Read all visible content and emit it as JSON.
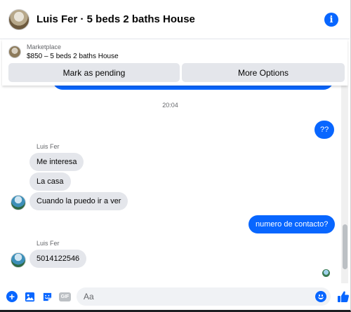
{
  "header": {
    "title": "Luis Fer · 5 beds 2 baths House",
    "info_icon": "info-icon"
  },
  "marketplace": {
    "label": "Marketplace",
    "listing": "$850 – 5 beds 2 baths House",
    "buttons": {
      "pending": "Mark as pending",
      "more": "More Options"
    }
  },
  "chat": {
    "timestamp": "20:04",
    "messages": [
      {
        "from": "me",
        "text": "??"
      },
      {
        "from": "them",
        "sender": "Luis Fer",
        "text": "Me interesa"
      },
      {
        "from": "them",
        "text": "La casa"
      },
      {
        "from": "them",
        "text": "Cuando la puedo ir a ver"
      },
      {
        "from": "me",
        "text": "numero de contacto?"
      },
      {
        "from": "them",
        "sender": "Luis Fer",
        "text": "5014122546"
      }
    ]
  },
  "composer": {
    "placeholder": "Aa",
    "gif_label": "GIF",
    "plus_glyph": "+"
  },
  "colors": {
    "accent": "#0866ff",
    "bubble_in": "#e4e6eb",
    "muted_text": "#65676b"
  }
}
